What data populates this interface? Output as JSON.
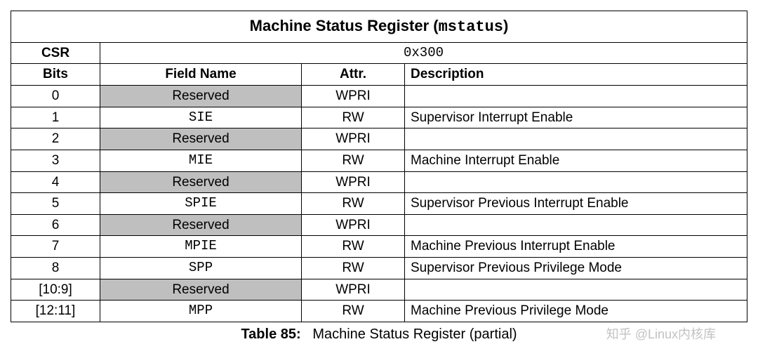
{
  "title": {
    "prefix": "Machine Status Register (",
    "code": "mstatus",
    "suffix": ")"
  },
  "csr": {
    "label": "CSR",
    "value": "0x300"
  },
  "headers": {
    "bits": "Bits",
    "field": "Field Name",
    "attr": "Attr.",
    "desc": "Description"
  },
  "rows": [
    {
      "bits": "0",
      "field": "Reserved",
      "attr": "WPRI",
      "desc": "",
      "reserved": true,
      "mono": false
    },
    {
      "bits": "1",
      "field": "SIE",
      "attr": "RW",
      "desc": "Supervisor Interrupt Enable",
      "reserved": false,
      "mono": true
    },
    {
      "bits": "2",
      "field": "Reserved",
      "attr": "WPRI",
      "desc": "",
      "reserved": true,
      "mono": false
    },
    {
      "bits": "3",
      "field": "MIE",
      "attr": "RW",
      "desc": "Machine Interrupt Enable",
      "reserved": false,
      "mono": true
    },
    {
      "bits": "4",
      "field": "Reserved",
      "attr": "WPRI",
      "desc": "",
      "reserved": true,
      "mono": false
    },
    {
      "bits": "5",
      "field": "SPIE",
      "attr": "RW",
      "desc": "Supervisor Previous Interrupt Enable",
      "reserved": false,
      "mono": true
    },
    {
      "bits": "6",
      "field": "Reserved",
      "attr": "WPRI",
      "desc": "",
      "reserved": true,
      "mono": false
    },
    {
      "bits": "7",
      "field": "MPIE",
      "attr": "RW",
      "desc": "Machine Previous Interrupt Enable",
      "reserved": false,
      "mono": true
    },
    {
      "bits": "8",
      "field": "SPP",
      "attr": "RW",
      "desc": "Supervisor Previous Privilege Mode",
      "reserved": false,
      "mono": true
    },
    {
      "bits": "[10:9]",
      "field": "Reserved",
      "attr": "WPRI",
      "desc": "",
      "reserved": true,
      "mono": false
    },
    {
      "bits": "[12:11]",
      "field": "MPP",
      "attr": "RW",
      "desc": "Machine Previous Privilege Mode",
      "reserved": false,
      "mono": true
    }
  ],
  "caption": {
    "label": "Table 85:",
    "text": "Machine Status Register (partial)"
  },
  "watermark": "知乎 @Linux内核库"
}
